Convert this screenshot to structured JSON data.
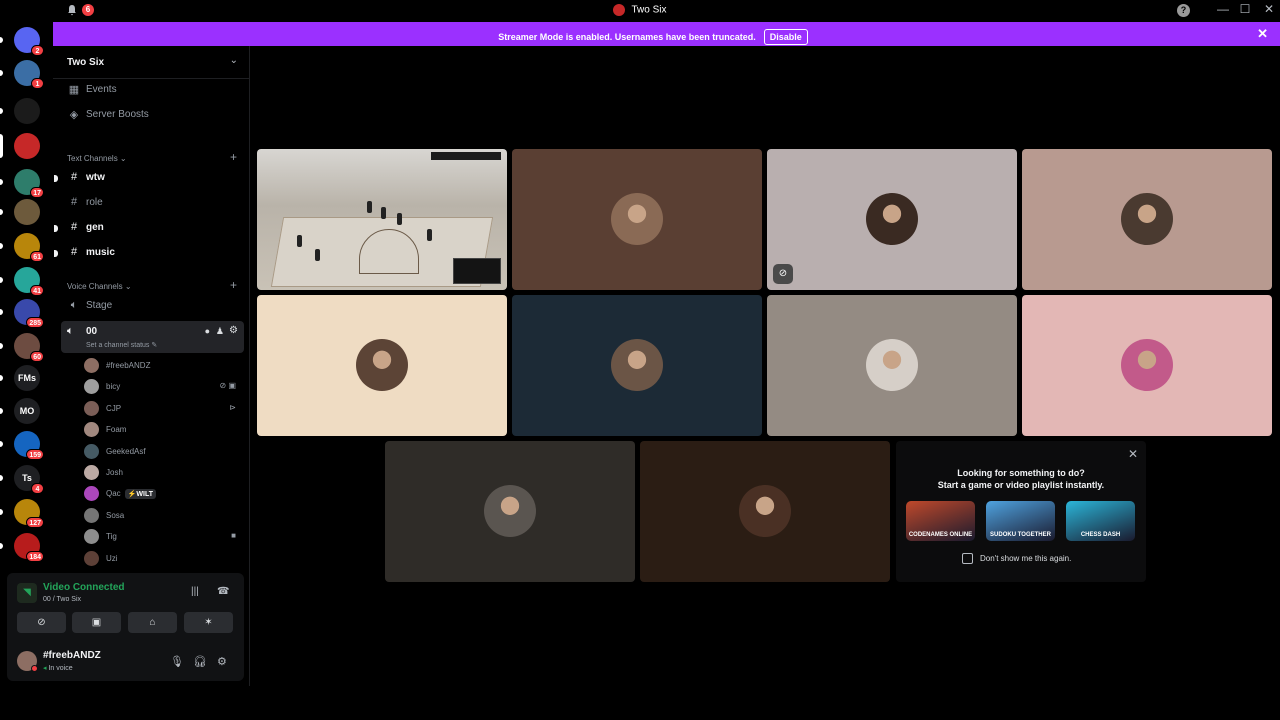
{
  "titlebar": {
    "title": "Two Six",
    "notification_count": "6",
    "help": "?",
    "minimize": "—",
    "maximize": "☐",
    "close": "✕"
  },
  "banner": {
    "text": "Streamer Mode is enabled. Usernames have been truncated.",
    "button": "Disable",
    "close": "✕"
  },
  "servers": [
    {
      "icon": "discord-icon",
      "label": "",
      "badge": "2",
      "color": "#5865f2"
    },
    {
      "icon": "globe-icon",
      "label": "",
      "badge": "1",
      "color": "#3b6ea5"
    },
    {
      "icon": "gta-icon",
      "label": "",
      "badge": "",
      "color": "#1b1b1b"
    },
    {
      "icon": "two-six-icon",
      "label": "",
      "badge": "",
      "color": "#c62828"
    },
    {
      "icon": "server-icon",
      "label": "",
      "badge": "17",
      "color": "#2e7d6b"
    },
    {
      "icon": "server-icon",
      "label": "",
      "badge": "",
      "color": "#6d5a3c"
    },
    {
      "icon": "server-icon",
      "label": "",
      "badge": "61",
      "color": "#b8860b"
    },
    {
      "icon": "server-icon",
      "label": "",
      "badge": "41",
      "color": "#26a69a"
    },
    {
      "icon": "server-icon",
      "label": "",
      "badge": "285",
      "color": "#3949ab"
    },
    {
      "icon": "server-icon",
      "label": "",
      "badge": "60",
      "color": "#6d4c41"
    },
    {
      "icon": "server-icon",
      "label": "FMs",
      "badge": "",
      "color": "#1e1f22"
    },
    {
      "icon": "server-icon",
      "label": "MO",
      "badge": "",
      "color": "#1e1f22"
    },
    {
      "icon": "server-icon",
      "label": "",
      "badge": "159",
      "color": "#1565c0"
    },
    {
      "icon": "server-icon",
      "label": "Ts",
      "badge": "4",
      "color": "#1e1f22"
    },
    {
      "icon": "server-icon",
      "label": "",
      "badge": "127",
      "color": "#b8860b"
    },
    {
      "icon": "server-icon",
      "label": "",
      "badge": "184",
      "color": "#b71c1c"
    }
  ],
  "sidebar": {
    "server_name": "Two Six",
    "items": [
      {
        "icon": "calendar-icon",
        "glyph": "▦",
        "label": "Events"
      },
      {
        "icon": "boost-icon",
        "glyph": "◈",
        "label": "Server Boosts"
      }
    ],
    "text_category": "Text Channels",
    "text_channels": [
      {
        "label": "wtw",
        "unread": true
      },
      {
        "label": "role",
        "unread": false
      },
      {
        "label": "gen",
        "unread": true
      },
      {
        "label": "music",
        "unread": true
      }
    ],
    "voice_category": "Voice Channels",
    "stage": "Stage",
    "active_voice": "00",
    "channel_status": "Set a channel status",
    "voice_users": [
      {
        "name": "#freebANDZ",
        "color": "#8d6e63",
        "side": ""
      },
      {
        "name": "bicy",
        "color": "#9e9e9e",
        "side": "⊘ ▣"
      },
      {
        "name": "CJP",
        "color": "#7b5e57",
        "side": "⊳"
      },
      {
        "name": "Foam",
        "color": "#a1887f",
        "side": ""
      },
      {
        "name": "GeekedAsf",
        "color": "#455a64",
        "side": ""
      },
      {
        "name": "Josh",
        "color": "#bcaaa4",
        "side": ""
      },
      {
        "name": "Qac",
        "color": "#ab47bc",
        "side": "",
        "tag": "⚡WILT"
      },
      {
        "name": "Sosa",
        "color": "#757575",
        "side": ""
      },
      {
        "name": "Tig",
        "color": "#8d8d8d",
        "side": "■"
      },
      {
        "name": "Uzi",
        "color": "#5d4037",
        "side": ""
      }
    ]
  },
  "voice_panel": {
    "status": "Video Connected",
    "sub": "00 / Two Six",
    "user_name": "#freebANDZ",
    "user_status": "In voice"
  },
  "tiles": [
    {
      "bg": "#5a3f33",
      "avatar": "#8a6a55"
    },
    {
      "bg": "#b9afaf",
      "avatar": "#3a2a22",
      "muted": true
    },
    {
      "bg": "#b89a90",
      "avatar": "#4a3a30"
    },
    {
      "bg": "#efdcc3",
      "avatar": "#5c4436"
    },
    {
      "bg": "#1c2a36",
      "avatar": "#6b5546"
    },
    {
      "bg": "#948b83",
      "avatar": "#d6cfc8"
    },
    {
      "bg": "#e3b7b5",
      "avatar": "#c25a8a"
    },
    {
      "bg": "#2f2c28",
      "avatar": "#5a5550"
    },
    {
      "bg": "#2b1d14",
      "avatar": "#4a3024"
    }
  ],
  "activity": {
    "line1": "Looking for something to do?",
    "line2": "Start a game or video playlist instantly.",
    "games": [
      {
        "label": "CODENAMES ONLINE",
        "color": "#c0492b"
      },
      {
        "label": "SUDOKU TOGETHER",
        "color": "#4fa3e0"
      },
      {
        "label": "CHESS DASH",
        "color": "#2bb6d9"
      }
    ],
    "checkbox_label": "Don't show me this again."
  }
}
